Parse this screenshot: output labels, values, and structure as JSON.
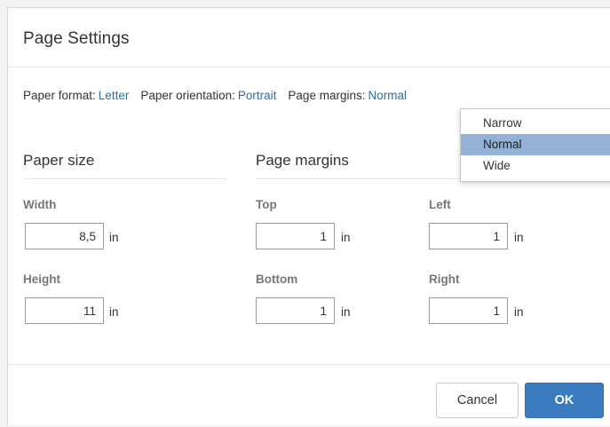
{
  "dialog": {
    "title": "Page Settings"
  },
  "settings_line": {
    "paper_format_label": "Paper format:",
    "paper_format_value": "Letter",
    "paper_orientation_label": "Paper orientation:",
    "paper_orientation_value": "Portrait",
    "page_margins_label": "Page margins:",
    "page_margins_value": "Normal"
  },
  "paper_size": {
    "title": "Paper size",
    "width_label": "Width",
    "width_value": "8,5",
    "height_label": "Height",
    "height_value": "11",
    "unit": "in"
  },
  "page_margins": {
    "title": "Page margins",
    "top_label": "Top",
    "top_value": "1",
    "left_label": "Left",
    "left_value": "1",
    "bottom_label": "Bottom",
    "bottom_value": "1",
    "right_label": "Right",
    "right_value": "1",
    "unit": "in"
  },
  "margins_dropdown": {
    "options": [
      "Narrow",
      "Normal",
      "Wide"
    ],
    "selected": "Normal"
  },
  "footer": {
    "cancel_label": "Cancel",
    "ok_label": "OK"
  },
  "colors": {
    "link": "#2e6ea6",
    "ok_button": "#3b7bbf",
    "dropdown_selected": "#93b1d4"
  }
}
